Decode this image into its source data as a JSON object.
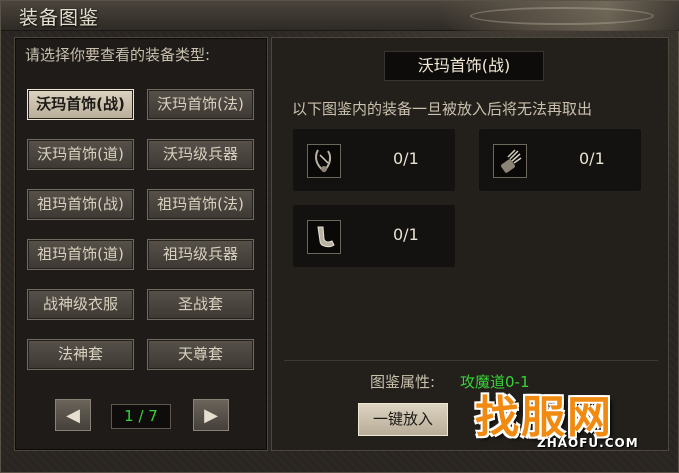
{
  "window": {
    "title": "装备图鉴"
  },
  "left": {
    "header": "请选择你要查看的装备类型:",
    "types": [
      {
        "label": "沃玛首饰(战)",
        "active": true
      },
      {
        "label": "沃玛首饰(法)",
        "active": false
      },
      {
        "label": "沃玛首饰(道)",
        "active": false
      },
      {
        "label": "沃玛级兵器",
        "active": false
      },
      {
        "label": "祖玛首饰(战)",
        "active": false
      },
      {
        "label": "祖玛首饰(法)",
        "active": false
      },
      {
        "label": "祖玛首饰(道)",
        "active": false
      },
      {
        "label": "祖玛级兵器",
        "active": false
      },
      {
        "label": "战神级衣服",
        "active": false
      },
      {
        "label": "圣战套",
        "active": false
      },
      {
        "label": "法神套",
        "active": false
      },
      {
        "label": "天尊套",
        "active": false
      }
    ],
    "pager": {
      "prev_icon": "left-arrow-icon",
      "next_icon": "right-arrow-icon",
      "page": "1 / 7"
    }
  },
  "right": {
    "set_title": "沃玛首饰(战)",
    "notice": "以下图鉴内的装备一旦被放入后将无法再取出",
    "slots": [
      {
        "icon": "necklace-icon",
        "count": "0/1"
      },
      {
        "icon": "bracelet-icon",
        "count": "0/1"
      },
      {
        "icon": "ring-icon",
        "count": "0/1"
      }
    ],
    "attr_label": "图鉴属性:",
    "attr_value": "攻魔道0-1",
    "oneclick_label": "一键放入"
  },
  "watermark": {
    "main": "找服网",
    "sub": "ZHAOFU.COM"
  },
  "colors": {
    "accent_green": "#38d238",
    "watermark_orange": "#f08a10"
  }
}
